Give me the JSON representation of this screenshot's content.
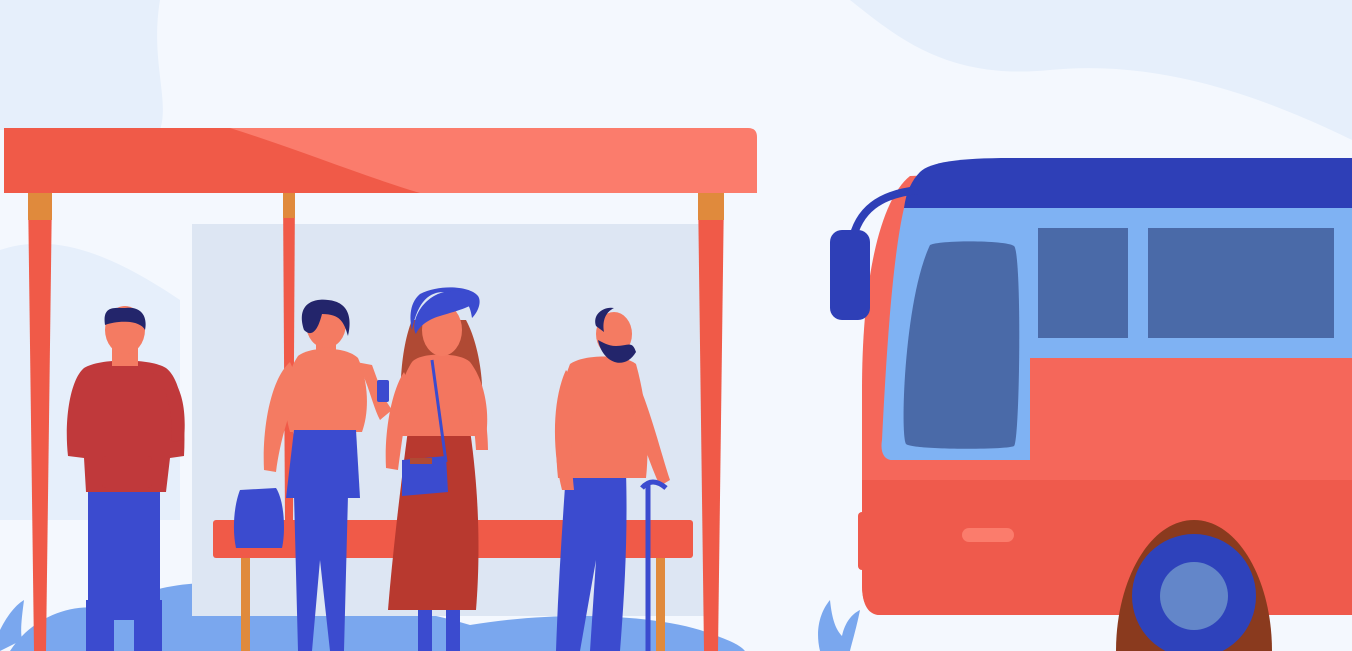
{
  "scene": {
    "subject": "bus-stop",
    "colors": {
      "background": "#f4f8fe",
      "cloud": "#e6effb",
      "shelter_red": "#f05a48",
      "shelter_red_light": "#fb7c6c",
      "pole_orange": "#e08a3c",
      "glass": "#dde6f3",
      "bus_blue_dark": "#2e3fb7",
      "bus_window_frame": "#7fb2f3",
      "bus_window_glass": "#4a6aa8",
      "bus_body": "#f5675a",
      "bus_body_lower": "#ef5a4c",
      "wheel_rim": "#8a3a1e",
      "wheel": "#2e42bb",
      "hub": "#6386c9",
      "ground_blue": "#7aa7ee",
      "jeans_blue": "#3b4bcf",
      "skin": "#f47b62",
      "coral_top": "#f3765f",
      "hoodie_red": "#c0393b",
      "hair_dark": "#23256b",
      "hair_brown": "#b04a34",
      "skirt_brown": "#b8392f"
    }
  }
}
